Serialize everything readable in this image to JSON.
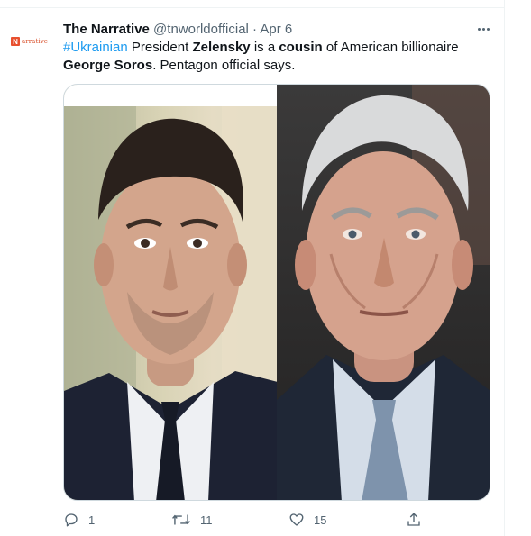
{
  "account": {
    "avatar_mark": "N",
    "avatar_word": "arrative",
    "display_name": "The Narrative",
    "handle": "@tnworldofficial",
    "separator": "·",
    "date": "Apr 6"
  },
  "tweet": {
    "hashtag": "#Ukrainian",
    "text_1": " President ",
    "bold_1": "Zelensky",
    "text_2": " is a ",
    "bold_2": "cousin",
    "text_3": " of American billionaire ",
    "bold_3": "George Soros",
    "text_4": ". Pentagon official says."
  },
  "media": {
    "left_photo": "portrait of man in suit (left)",
    "right_photo": "portrait of elderly man in suit (right)"
  },
  "actions": {
    "reply_count": "1",
    "retweet_count": "11",
    "like_count": "15"
  },
  "colors": {
    "link": "#1d9bf0",
    "text": "#0f1419",
    "secondary": "#536471",
    "brand": "#e8502f"
  }
}
